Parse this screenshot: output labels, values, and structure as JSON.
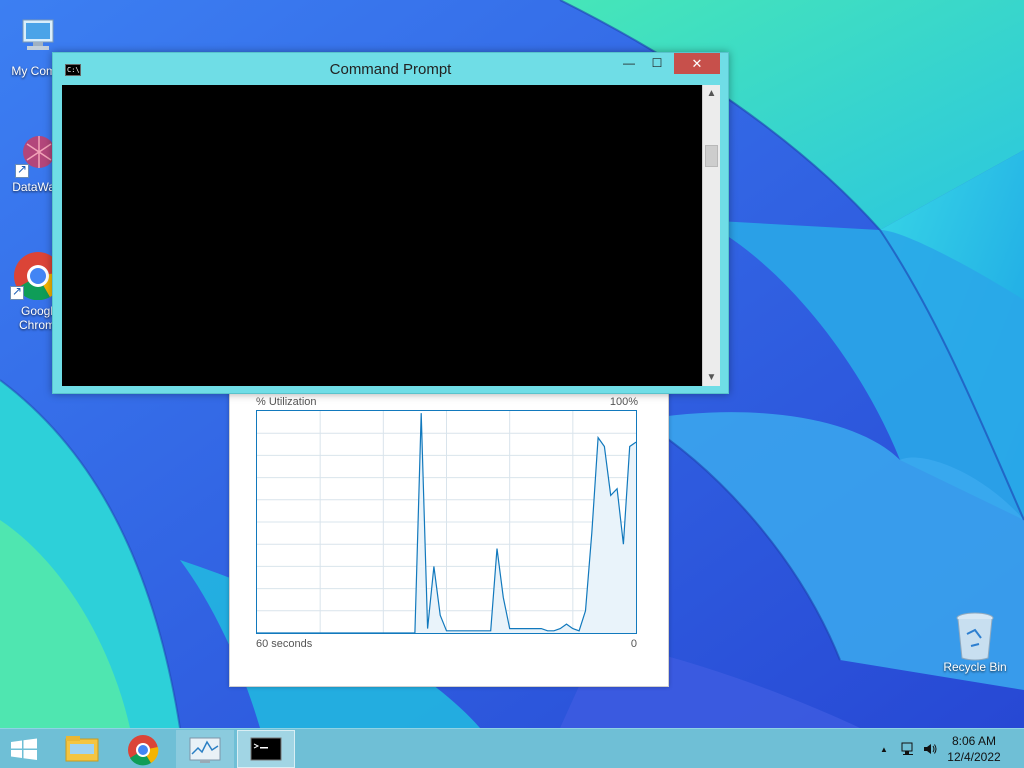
{
  "desktop": {
    "icons": [
      {
        "label": "My Comp"
      },
      {
        "label": "DataWag"
      },
      {
        "label": "Googl",
        "label2": "Chrom"
      }
    ],
    "recycle_bin": {
      "label": "Recycle Bin"
    }
  },
  "cmd_window": {
    "title": "Command Prompt",
    "icon_text": "C:\\",
    "min_glyph": "—",
    "max_glyph": "☐",
    "close_glyph": "✕",
    "scroll_up": "▲",
    "scroll_down": "▼"
  },
  "perf_window": {
    "top_left": "% Utilization",
    "top_right": "100%",
    "bottom_left": "60 seconds",
    "bottom_right": "0",
    "line_color": "#1279bd"
  },
  "chart_data": {
    "type": "area",
    "x": [
      0,
      1,
      2,
      3,
      4,
      5,
      6,
      7,
      8,
      9,
      10,
      11,
      12,
      13,
      14,
      15,
      16,
      17,
      18,
      19,
      20,
      21,
      22,
      23,
      24,
      25,
      26,
      27,
      28,
      29,
      30,
      31,
      32,
      33,
      34,
      35,
      36,
      37,
      38,
      39,
      40,
      41,
      42,
      43,
      44,
      45,
      46,
      47,
      48,
      49,
      50,
      51,
      52,
      53,
      54,
      55,
      56,
      57,
      58,
      59,
      60
    ],
    "values": [
      0,
      0,
      0,
      0,
      0,
      0,
      0,
      0,
      0,
      0,
      0,
      0,
      0,
      0,
      0,
      0,
      0,
      0,
      0,
      0,
      0,
      0,
      0,
      0,
      0,
      0,
      99,
      2,
      30,
      8,
      1,
      1,
      1,
      1,
      1,
      1,
      1,
      1,
      38,
      16,
      2,
      2,
      2,
      2,
      2,
      2,
      1,
      1,
      2,
      4,
      2,
      1,
      10,
      45,
      88,
      84,
      62,
      65,
      40,
      84,
      86
    ],
    "ylim": [
      0,
      100
    ],
    "grid": true
  },
  "taskbar": {
    "apps": [
      {
        "name": "file-explorer"
      },
      {
        "name": "google-chrome"
      },
      {
        "name": "resource-monitor"
      },
      {
        "name": "command-prompt",
        "active": true
      }
    ],
    "tray": {
      "chevron": "▲",
      "time": "8:06 AM",
      "date": "12/4/2022"
    }
  }
}
